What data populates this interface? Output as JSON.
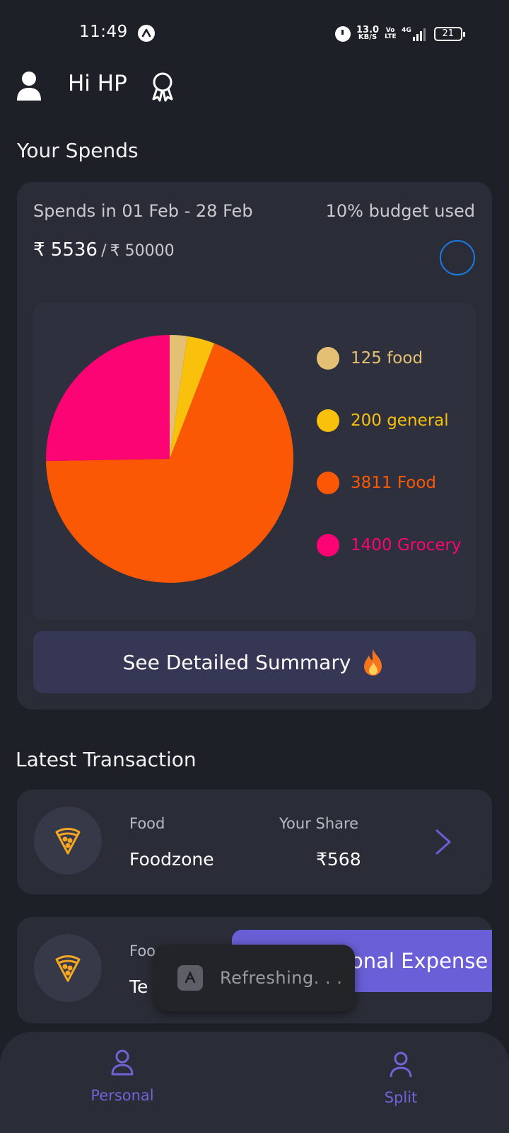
{
  "status_bar": {
    "time": "11:49",
    "net_speed_value": "13.0",
    "net_speed_unit": "KB/S",
    "volte": "Vo LTE",
    "network": "4G",
    "battery": "21"
  },
  "header": {
    "greeting": "Hi HP",
    "user_icon": "user-icon",
    "award_icon": "award-icon"
  },
  "spends": {
    "section_title": "Your Spends",
    "range_label": "Spends in 01 Feb - 28 Feb",
    "budget_used_label": "10% budget used",
    "spent": "₹ 5536",
    "separator": "/",
    "budget": "₹ 50000",
    "budget_used_fraction": 0.1,
    "summary_button_label": "See Detailed Summary",
    "summary_button_icon": "fire-icon"
  },
  "chart_data": {
    "type": "pie",
    "slices": [
      {
        "label": "125 food",
        "value": 125,
        "color": "#e4c074"
      },
      {
        "label": "200 general",
        "value": 200,
        "color": "#f9c00c"
      },
      {
        "label": "3811 Food",
        "value": 3811,
        "color": "#fb5806"
      },
      {
        "label": "1400 Grocery",
        "value": 1400,
        "color": "#fd0474"
      }
    ]
  },
  "transactions": {
    "section_title": "Latest Transaction",
    "items": [
      {
        "category": "Food",
        "merchant": "Foodzone",
        "share_label": "Your Share",
        "share": "₹568",
        "icon": "pizza-icon"
      },
      {
        "category": "Foo",
        "merchant": "Te",
        "icon": "pizza-icon"
      }
    ]
  },
  "fab": {
    "label": "onal Expense"
  },
  "toast": {
    "text": "Refreshing. . ."
  },
  "nav": {
    "items": [
      {
        "label": "Personal",
        "icon": "person-icon"
      },
      {
        "label": "Split",
        "icon": "person-icon"
      }
    ]
  },
  "colors": {
    "background": "#1e2028",
    "card": "#2a2d37",
    "accent": "#6a5fd6",
    "nav_active": "#7164d8"
  }
}
